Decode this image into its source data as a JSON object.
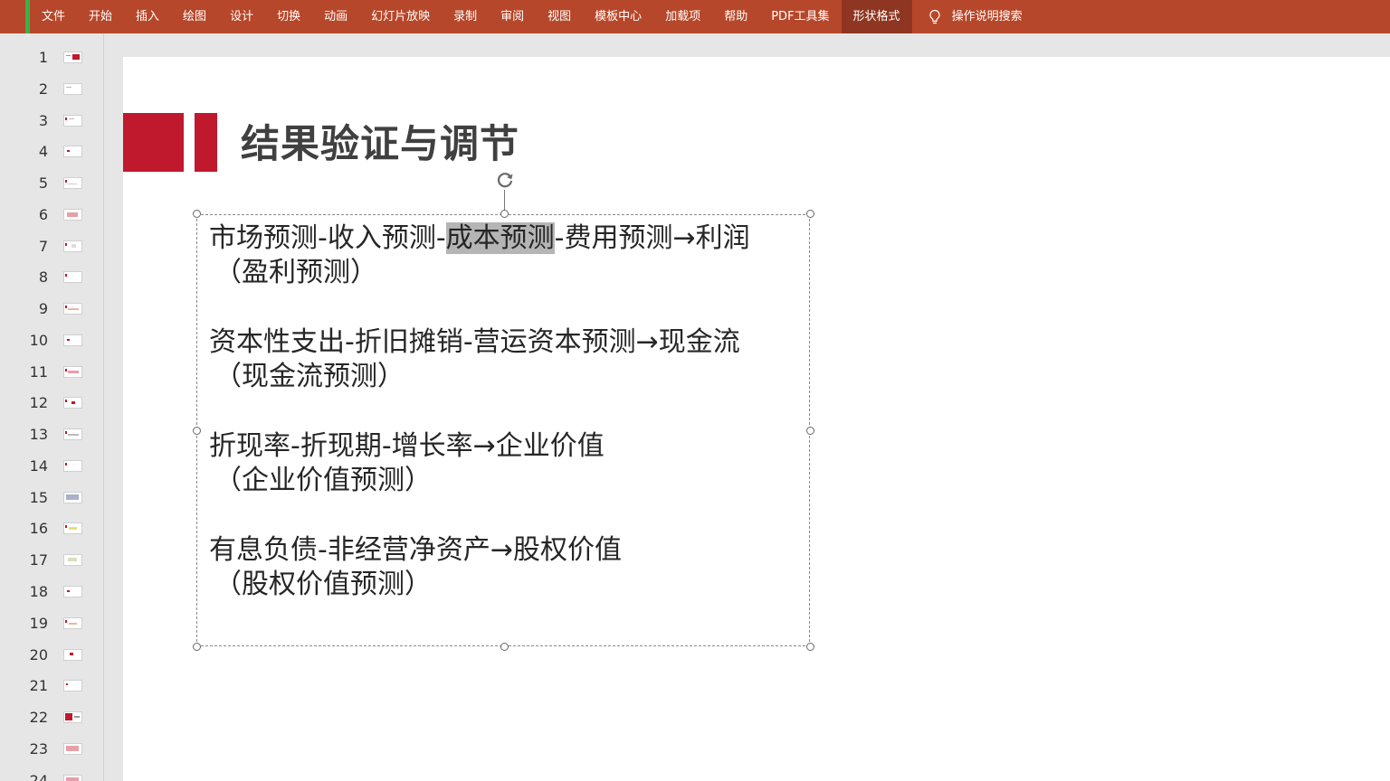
{
  "ribbon": {
    "tabs": [
      "文件",
      "开始",
      "插入",
      "绘图",
      "设计",
      "切换",
      "动画",
      "幻灯片放映",
      "录制",
      "审阅",
      "视图",
      "模板中心",
      "加载项",
      "帮助",
      "PDF工具集",
      "形状格式"
    ],
    "active_tab": "形状格式",
    "search_label": "操作说明搜索",
    "colors": {
      "bar": "#b7472a",
      "active": "#8e3621"
    }
  },
  "thumbnails": {
    "numbers": [
      "1",
      "2",
      "3",
      "4",
      "5",
      "6",
      "7",
      "8",
      "9",
      "10",
      "11",
      "12",
      "13",
      "14",
      "15",
      "16",
      "17",
      "18",
      "19",
      "20",
      "21",
      "22",
      "23",
      "24"
    ]
  },
  "slide": {
    "title": "结果验证与调节",
    "accent_color": "#c0182d",
    "paragraphs": [
      {
        "line_before": "市场预测-收入预测-",
        "line_selected": "成本预测",
        "line_after": "-费用预测→利润",
        "sub": "（盈利预测）"
      },
      {
        "line_before": "资本性支出-折旧摊销-营运资本预测→现金流",
        "line_selected": "",
        "line_after": "",
        "sub": "（现金流预测）"
      },
      {
        "line_before": "折现率-折现期-增长率→企业价值",
        "line_selected": "",
        "line_after": "",
        "sub": "（企业价值预测）"
      },
      {
        "line_before": "有息负债-非经营净资产→股权价值",
        "line_selected": "",
        "line_after": "",
        "sub": "（股权价值预测）"
      }
    ]
  }
}
